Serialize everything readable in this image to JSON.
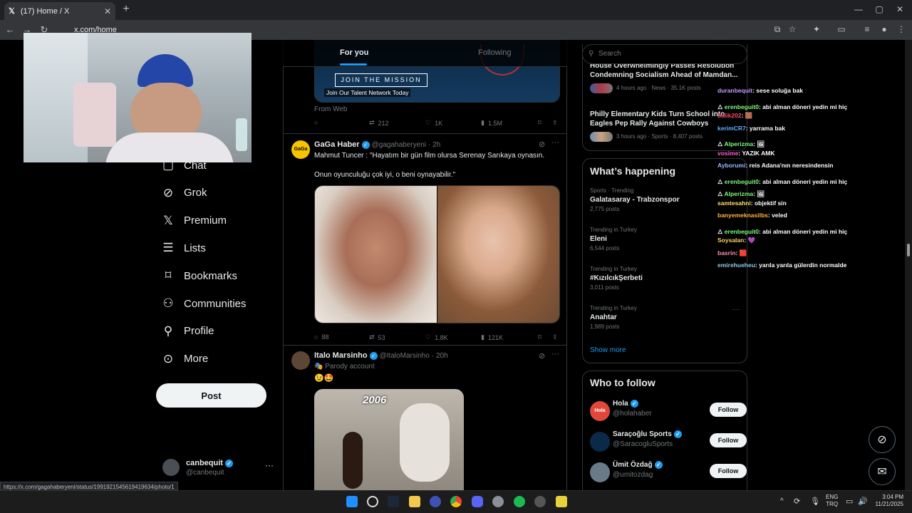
{
  "browser": {
    "tab_title": "(17) Home / X",
    "url": "x.com/home",
    "status_url": "https://x.com/gagahaberyeni/status/1991921545619419634/photo/1"
  },
  "nav": {
    "items": [
      {
        "label": "Chat",
        "icon": "chat-icon"
      },
      {
        "label": "Grok",
        "icon": "grok-icon"
      },
      {
        "label": "Premium",
        "icon": "x-logo-icon"
      },
      {
        "label": "Lists",
        "icon": "list-icon"
      },
      {
        "label": "Bookmarks",
        "icon": "bookmark-icon"
      },
      {
        "label": "Communities",
        "icon": "communities-icon"
      },
      {
        "label": "Profile",
        "icon": "person-icon"
      },
      {
        "label": "More",
        "icon": "more-circle-icon"
      }
    ],
    "post_label": "Post",
    "account": {
      "name": "canbequit",
      "handle": "@canbequit"
    }
  },
  "timeline": {
    "tabs": [
      "For you",
      "Following"
    ],
    "ad": {
      "cta": "JOIN THE MISSION",
      "caption": "Join Our Talent Network Today",
      "source": "From Web",
      "retweets": "212",
      "likes": "1K",
      "views": "1.5M"
    },
    "posts": [
      {
        "name": "GaGa Haber",
        "handle": "@gagahaberyeni",
        "time": "· 2h",
        "avatar_text": "GaGa",
        "text1": "Mahmut Tuncer : \"Hayatım bir gün film olursa Serenay Sarıkaya oynasın.",
        "text2": "Onun oyunculuğu çok iyi, o beni oynayabilir.\"",
        "replies": "88",
        "retweets": "53",
        "likes": "1.8K",
        "views": "121K"
      },
      {
        "name": "Italo Marsinho",
        "handle": "@ItaloMarsinho",
        "time": "· 20h",
        "badge": "Parody account",
        "emoji": "😉🤩",
        "image_caption": "2006"
      }
    ]
  },
  "right": {
    "search_placeholder": "Search",
    "news": [
      {
        "title": "House Overwhelmingly Passes Resolution Condemning Socialism Ahead of Mamdan...",
        "meta": "4 hours ago · News · 35.1K posts"
      },
      {
        "title": "Philly Elementary Kids Turn School into Eagles Pep Rally Against Cowboys",
        "meta": "3 hours ago · Sports · 8,407 posts"
      }
    ],
    "whats_happening": "What’s happening",
    "trends": [
      {
        "context": "Sports · Trending",
        "title": "Galatasaray - Trabzonspor",
        "posts": "2,775 posts"
      },
      {
        "context": "Trending in Turkey",
        "title": "Eleni",
        "posts": "6,544 posts"
      },
      {
        "context": "Trending in Turkey",
        "title": "#KızılcıkŞerbeti",
        "posts": "3,011 posts"
      },
      {
        "context": "Trending in Turkey",
        "title": "Anahtar",
        "posts": "1,989 posts"
      }
    ],
    "show_more": "Show more",
    "who_to_follow": "Who to follow",
    "follow_label": "Follow",
    "suggestions": [
      {
        "name": "Hola",
        "handle": "@holahaber",
        "color": "#e0483a",
        "avatar_text": "Hola"
      },
      {
        "name": "Saraçoğlu Sports",
        "handle": "@SaracogluSports",
        "color": "#0b2a4a",
        "avatar_text": ""
      },
      {
        "name": "Ümit Özdağ",
        "handle": "@umitozdag",
        "color": "#6b7a88",
        "avatar_text": ""
      }
    ]
  },
  "chat_overlay": [
    {
      "user": "duranbequit",
      "msg": ": sese soluğa bak",
      "color": "#c49cff"
    },
    {
      "user": "erenbeguit0",
      "msg": ": abi alman döneri yedin mi hiç",
      "color": "#7cfc7c",
      "icon": true
    },
    {
      "user": "balik202",
      "msg": ": 🟫",
      "color": "#ff4d6d"
    },
    {
      "user": "kerimCR7",
      "msg": ": yarrama bak",
      "color": "#5fb0ff"
    },
    {
      "user": "Alperizma",
      "msg": ": 🖼",
      "color": "#7cfc7c",
      "icon": true
    },
    {
      "user": "vosime",
      "msg": ": YAZIK AMK",
      "color": "#ff5fd2"
    },
    {
      "user": "Ayborumi",
      "msg": ": reis Adana'nın neresindensin",
      "color": "#9ab8ff"
    },
    {
      "user": "erenbeguit0",
      "msg": ": abi alman döneri yedin mi hiç",
      "color": "#7cfc7c",
      "icon": true
    },
    {
      "user": "Alperizma",
      "msg": ": 🖼",
      "color": "#7cfc7c",
      "icon": true
    },
    {
      "user": "samtesahni",
      "msg": ": objektif sin",
      "color": "#ffe066"
    },
    {
      "user": "banyemeknasilbs",
      "msg": ": veled",
      "color": "#ffb347"
    },
    {
      "user": "erenbeguit0",
      "msg": ": abi alman döneri yedin mi hiç",
      "color": "#7cfc7c",
      "icon": true
    },
    {
      "user": "Soysalan",
      "msg": ": 💜",
      "color": "#ffd166"
    },
    {
      "user": "basrin",
      "msg": ": 🟥",
      "color": "#ff8fab"
    },
    {
      "user": "emirehueheu",
      "msg": ": yarıla yarıla gülerdin normalde",
      "color": "#8ecae6"
    }
  ],
  "taskbar": {
    "lang1": "ENG",
    "lang2": "TRQ",
    "time": "3:04 PM",
    "date": "11/21/2025"
  }
}
